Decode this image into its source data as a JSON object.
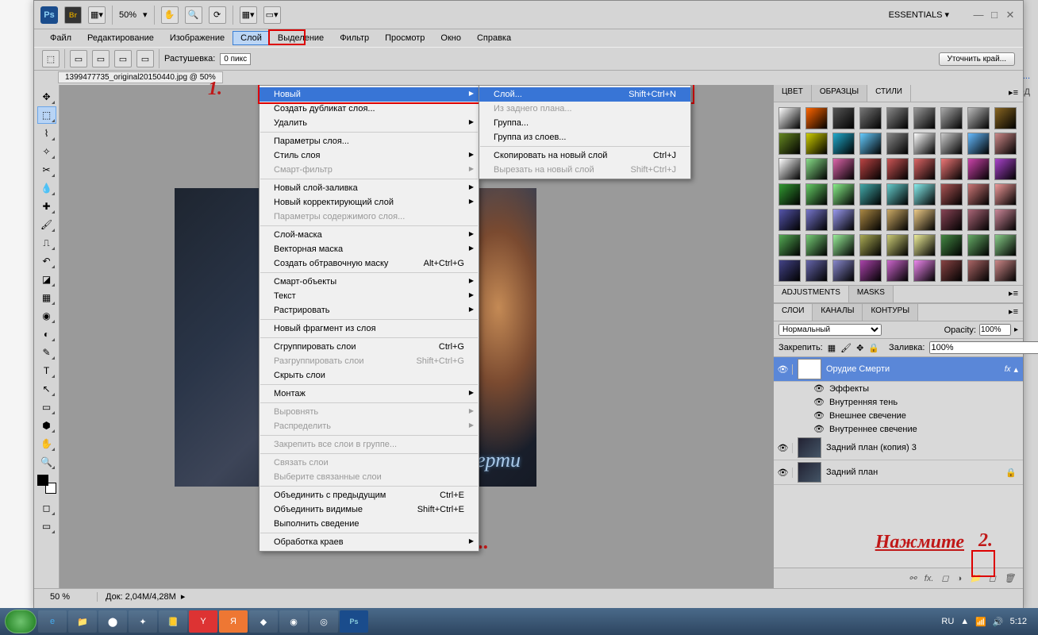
{
  "window": {
    "minimize": "—",
    "maximize": "□",
    "close": "✕"
  },
  "toolbar": {
    "zoom": "50%",
    "essentials": "ESSENTIALS ▾"
  },
  "menubar": [
    "Файл",
    "Редактирование",
    "Изображение",
    "Слой",
    "Выделение",
    "Фильтр",
    "Просмотр",
    "Окно",
    "Справка"
  ],
  "optbar": {
    "feather_label": "Растушевка:",
    "feather_val": "0 пикс",
    "refine": "Уточнить край..."
  },
  "doctab": "1399477735_original20150440.jpg @ 50%",
  "dropdown": [
    {
      "t": "Новый",
      "hl": true,
      "arr": true
    },
    {
      "t": "Создать дубликат слоя...",
      "arr": false
    },
    {
      "t": "Удалить",
      "arr": true
    },
    {
      "sep": true
    },
    {
      "t": "Параметры слоя..."
    },
    {
      "t": "Стиль слоя",
      "arr": true
    },
    {
      "t": "Смарт-фильтр",
      "dis": true,
      "arr": true
    },
    {
      "sep": true
    },
    {
      "t": "Новый слой-заливка",
      "arr": true
    },
    {
      "t": "Новый корректирующий слой",
      "arr": true
    },
    {
      "t": "Параметры содержимого слоя...",
      "dis": true
    },
    {
      "sep": true
    },
    {
      "t": "Слой-маска",
      "arr": true
    },
    {
      "t": "Векторная маска",
      "arr": true
    },
    {
      "t": "Создать обтравочную маску",
      "sc": "Alt+Ctrl+G"
    },
    {
      "sep": true
    },
    {
      "t": "Смарт-объекты",
      "arr": true
    },
    {
      "t": "Текст",
      "arr": true
    },
    {
      "t": "Растрировать",
      "arr": true
    },
    {
      "sep": true
    },
    {
      "t": "Новый фрагмент из слоя"
    },
    {
      "sep": true
    },
    {
      "t": "Сгруппировать слои",
      "sc": "Ctrl+G"
    },
    {
      "t": "Разгруппировать слои",
      "dis": true,
      "sc": "Shift+Ctrl+G"
    },
    {
      "t": "Скрыть слои"
    },
    {
      "sep": true
    },
    {
      "t": "Монтаж",
      "arr": true
    },
    {
      "sep": true
    },
    {
      "t": "Выровнять",
      "dis": true,
      "arr": true
    },
    {
      "t": "Распределить",
      "dis": true,
      "arr": true
    },
    {
      "sep": true
    },
    {
      "t": "Закрепить все слои в группе...",
      "dis": true
    },
    {
      "sep": true
    },
    {
      "t": "Связать слои",
      "dis": true
    },
    {
      "t": "Выберите связанные слои",
      "dis": true
    },
    {
      "sep": true
    },
    {
      "t": "Объединить с предыдущим",
      "sc": "Ctrl+E"
    },
    {
      "t": "Объединить видимые",
      "sc": "Shift+Ctrl+E"
    },
    {
      "t": "Выполнить сведение"
    },
    {
      "sep": true
    },
    {
      "t": "Обработка краев",
      "arr": true
    }
  ],
  "submenu": [
    {
      "t": "Слой...",
      "hl": true,
      "sc": "Shift+Ctrl+N"
    },
    {
      "t": "Из заднего плана...",
      "dis": true
    },
    {
      "t": "Группа..."
    },
    {
      "t": "Группа из слоев..."
    },
    {
      "sep": true
    },
    {
      "t": "Скопировать на новый слой",
      "sc": "Ctrl+J"
    },
    {
      "t": "Вырезать на новый слой",
      "dis": true,
      "sc": "Shift+Ctrl+J"
    }
  ],
  "canvas": {
    "stamp": "е Смерти",
    "ili": "Или..."
  },
  "anno": {
    "num1": "1.",
    "num2": "2.",
    "press": "Нажмите"
  },
  "panels": {
    "top_tabs": [
      "ЦВЕТ",
      "ОБРАЗЦЫ",
      "СТИЛИ"
    ],
    "adj_tabs": [
      "ADJUSTMENTS",
      "MASKS"
    ],
    "lyr_tabs": [
      "СЛОИ",
      "КАНАЛЫ",
      "КОНТУРЫ"
    ],
    "blend": "Нормальный",
    "opacity_l": "Opacity:",
    "opacity_v": "100%",
    "lock_l": "Закрепить:",
    "fill_l": "Заливка:",
    "fill_v": "100%"
  },
  "layers": {
    "l1": "Орудие Смерти",
    "fx": "fx",
    "eff": "Эффекты",
    "e1": "Внутренняя тень",
    "e2": "Внешнее свечение",
    "e3": "Внутреннее свечение",
    "l2": "Задний план (копия) 3",
    "l3": "Задний план"
  },
  "styles_colors": [
    "#fff",
    "#f60",
    "#555",
    "#777",
    "#888",
    "#999",
    "#aaa",
    "#bbb",
    "#886622",
    "#668822",
    "#cc0",
    "#22aacc",
    "#6cf",
    "#888",
    "#fff",
    "#ccc",
    "#6bf",
    "#c88",
    "#fff",
    "#8d8",
    "#d6a",
    "#b44",
    "#c55",
    "#d66",
    "#e77",
    "#c4a",
    "#a4c",
    "#393",
    "#6c6",
    "#8e8",
    "#4aa",
    "#6cc",
    "#8ee",
    "#a55",
    "#c77",
    "#e99",
    "#55a",
    "#77c",
    "#99e",
    "#a84",
    "#ca6",
    "#ec8",
    "#845",
    "#a67",
    "#c89",
    "#5a5",
    "#7c7",
    "#9e9",
    "#aa5",
    "#cc7",
    "#ee9",
    "#484",
    "#6a6",
    "#8c8",
    "#448",
    "#66a",
    "#88c",
    "#a4a",
    "#c6c",
    "#e8e",
    "#844",
    "#a66",
    "#c88",
    "#fff",
    "#555",
    "#888",
    "#944",
    "#b44",
    "#777",
    "#b66",
    "#999",
    "#c44"
  ],
  "status": {
    "zoom": "50 %",
    "doc": "Док: 2,04M/4,28M"
  },
  "tray": {
    "lang": "RU",
    "time": "5:12"
  },
  "right_strip": {
    "link1": "азет -...",
    "exit": "ВЫХОД"
  }
}
